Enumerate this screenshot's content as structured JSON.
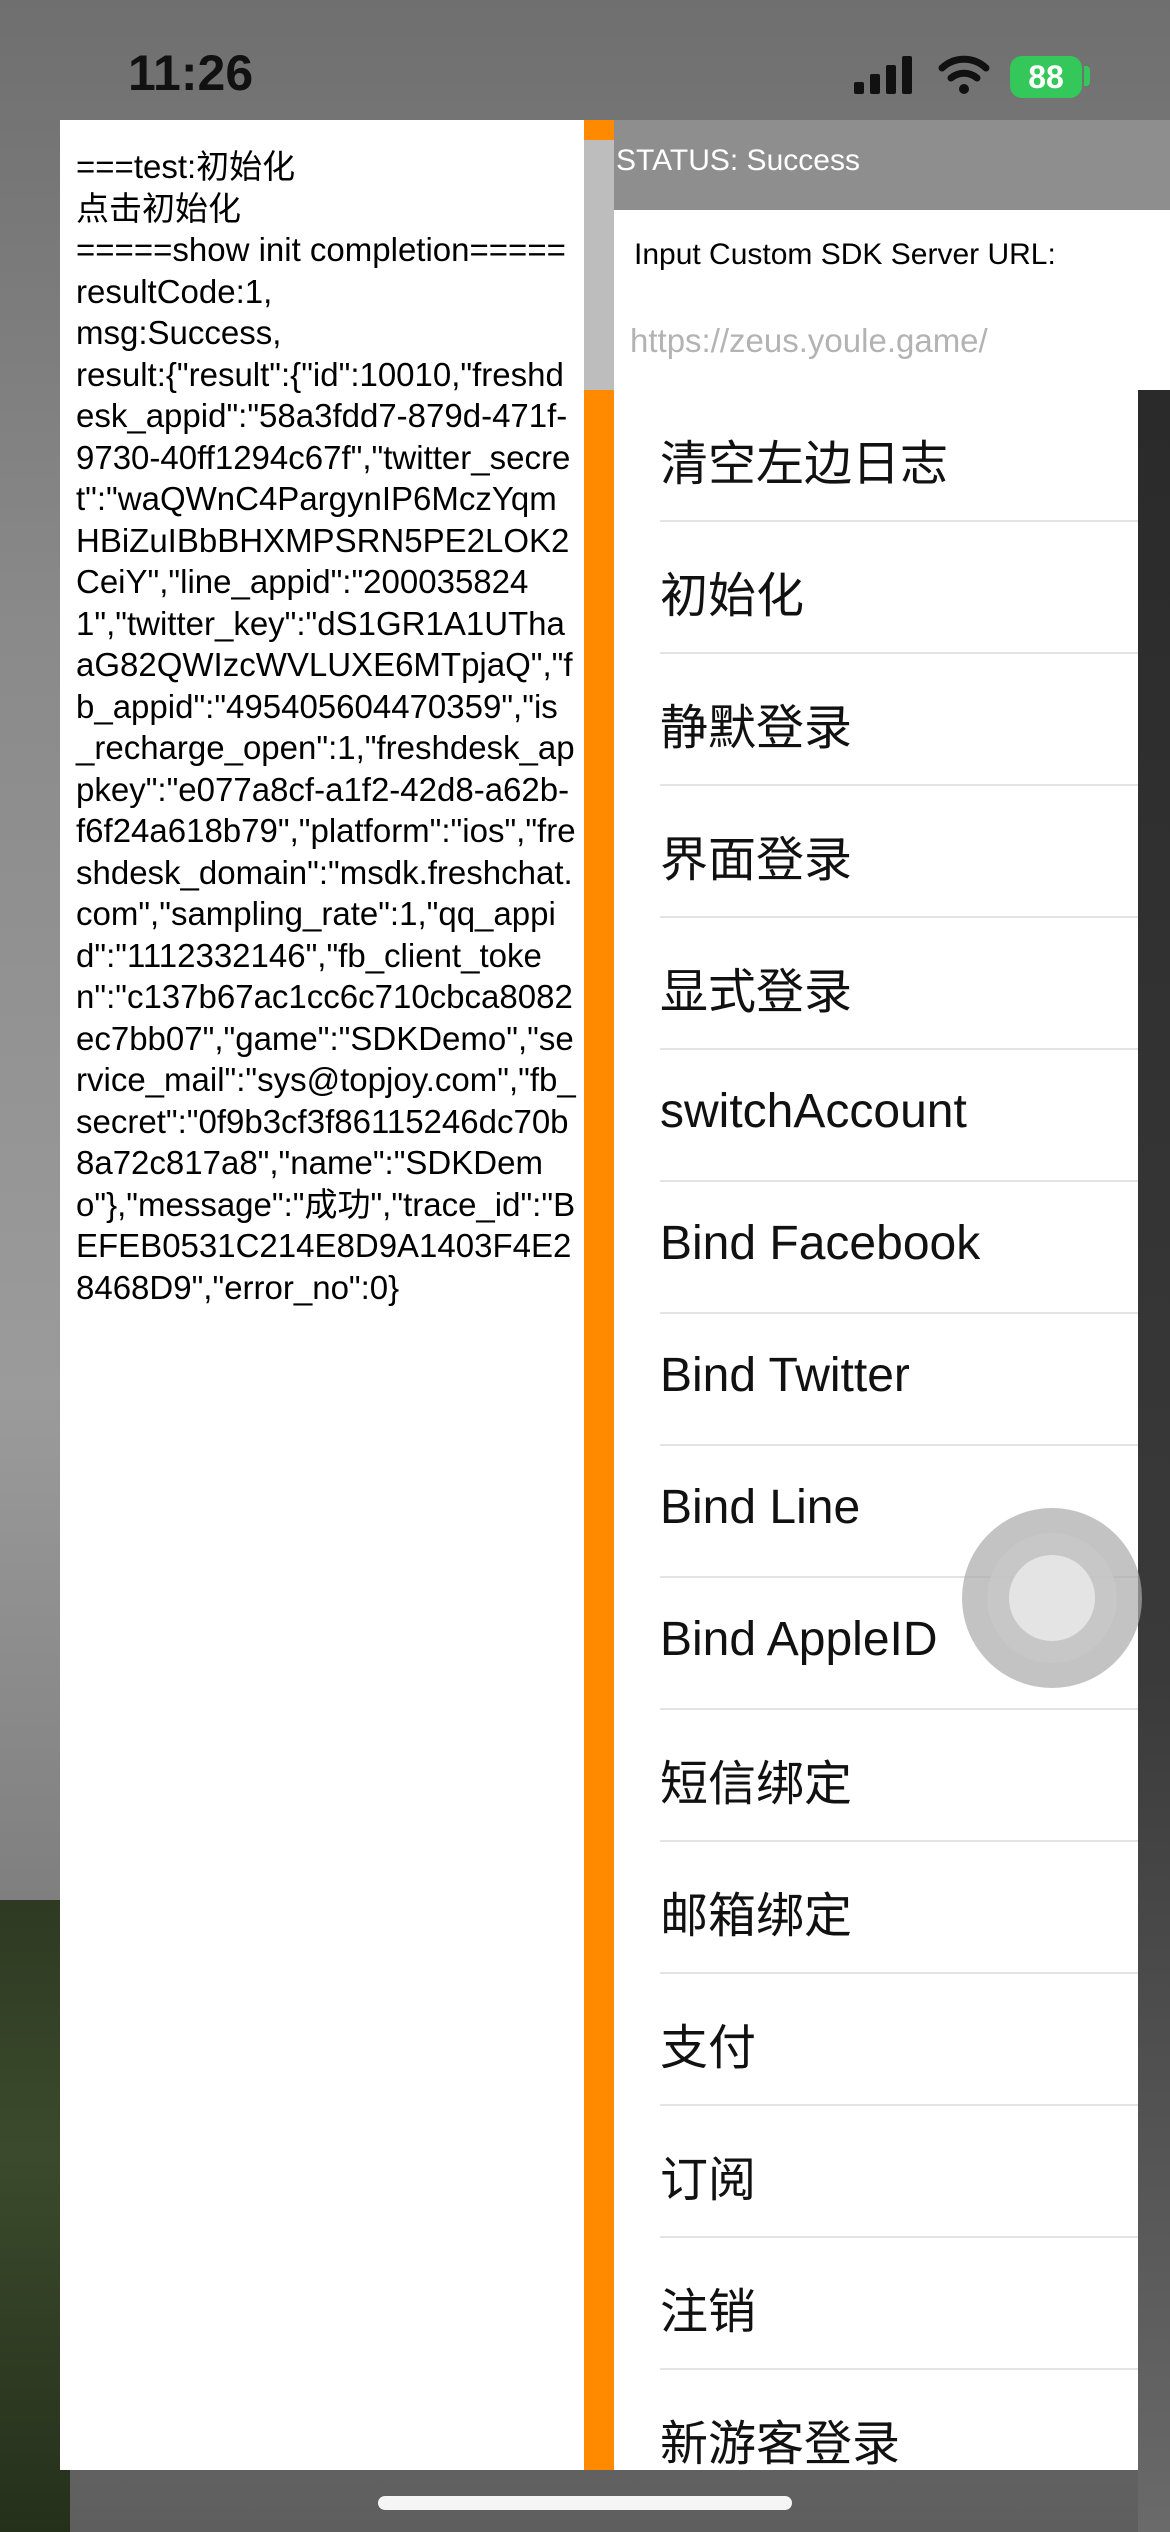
{
  "status_bar": {
    "time": "11:26",
    "battery": "88"
  },
  "log": {
    "text": "===test:初始化\n点击初始化\n=====show init completion=====\nresultCode:1,\nmsg:Success,\nresult:{\"result\":{\"id\":10010,\"freshdesk_appid\":\"58a3fdd7-879d-471f-9730-40ff1294c67f\",\"twitter_secret\":\"waQWnC4PargynIP6MczYqmHBiZuIBbBHXMPSRN5PE2LOK2CeiY\",\"line_appid\":\"2000358241\",\"twitter_key\":\"dS1GR1A1UThaaG82QWIzcWVLUXE6MTpjaQ\",\"fb_appid\":\"495405604470359\",\"is_recharge_open\":1,\"freshdesk_appkey\":\"e077a8cf-a1f2-42d8-a62b-f6f24a618b79\",\"platform\":\"ios\",\"freshdesk_domain\":\"msdk.freshchat.com\",\"sampling_rate\":1,\"qq_appid\":\"1112332146\",\"fb_client_token\":\"c137b67ac1cc6c710cbca8082ec7bb07\",\"game\":\"SDKDemo\",\"service_mail\":\"sys@topjoy.com\",\"fb_secret\":\"0f9b3cf3f86115246dc70b8a72c817a8\",\"name\":\"SDKDemo\"},\"message\":\"成功\",\"trace_id\":\"BEFEB0531C214E8D9A1403F4E28468D9\",\"error_no\":0}"
  },
  "status": {
    "text": "STATUS: Success"
  },
  "server_url": {
    "label": "Input Custom SDK Server URL:",
    "placeholder": "https://zeus.youle.game/"
  },
  "menu": {
    "items": [
      "清空左边日志",
      "初始化",
      "静默登录",
      "界面登录",
      "显式登录",
      "switchAccount",
      "Bind Facebook",
      "Bind Twitter",
      "Bind Line",
      "Bind AppleID",
      "短信绑定",
      "邮箱绑定",
      "支付",
      "订阅",
      "注销",
      "新游客登录"
    ]
  },
  "colors": {
    "accent_scroll": "#ff8a00",
    "status_header": "#8e8e8e",
    "battery": "#34c759"
  }
}
